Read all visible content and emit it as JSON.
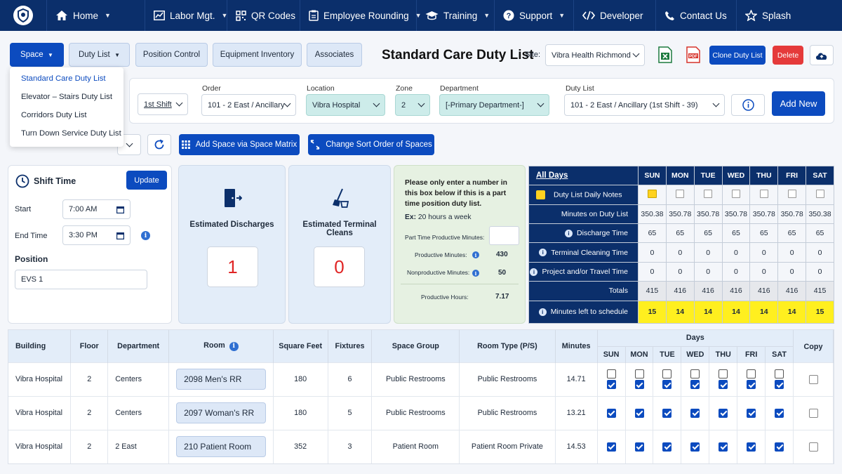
{
  "nav": {
    "items": [
      {
        "label": "Home",
        "icon": "house-icon"
      },
      {
        "label": "Labor Mgt.",
        "icon": "chart-icon"
      },
      {
        "label": "QR Codes",
        "icon": "qr-icon"
      },
      {
        "label": "Employee Rounding",
        "icon": "clipboard-icon"
      },
      {
        "label": "Training",
        "icon": "graduation-cap-icon"
      },
      {
        "label": "Support",
        "icon": "question-icon"
      },
      {
        "label": "Developer",
        "icon": "code-icon"
      },
      {
        "label": "Contact Us",
        "icon": "phone-icon"
      },
      {
        "label": "Splash",
        "icon": "star-icon"
      }
    ]
  },
  "toolbar": {
    "space": "Space",
    "duty_list": "Duty List",
    "position_control": "Position Control",
    "equipment_inventory": "Equipment Inventory",
    "associates": "Associates",
    "page_title": "Standard Care Duty List",
    "site_label": "Site:",
    "site_value": "Vibra Health Richmond",
    "clone": "Clone Duty List",
    "delete": "Delete"
  },
  "space_menu": [
    "Standard Care Duty List",
    "Elevator – Stairs Duty List",
    "Corridors Duty List",
    "Turn Down Service Duty List"
  ],
  "filters": {
    "shift": "1st Shift",
    "order_label": "Order",
    "order": "101 - 2 East / Ancillary",
    "location_label": "Location",
    "location": "Vibra Hospital",
    "zone_label": "Zone",
    "zone": "2",
    "department_label": "Department",
    "department": "[-Primary Department-]",
    "duty_list_label": "Duty List",
    "duty_list": "101 - 2 East / Ancillary (1st Shift - 39)",
    "add_new": "Add New"
  },
  "actions": {
    "add_space": "Add Space via Space Matrix",
    "change_sort": "Change Sort Order of Spaces"
  },
  "shift": {
    "title": "Shift Time",
    "update": "Update",
    "start_label": "Start",
    "start": "7:00 AM",
    "end_label": "End Time",
    "end": "3:30 PM",
    "position_label": "Position",
    "position": "EVS 1"
  },
  "estimates": {
    "discharges_label": "Estimated Discharges",
    "discharges": "1",
    "terminal_label": "Estimated Terminal Cleans",
    "terminal": "0"
  },
  "part_time": {
    "note": "Please only enter a number in this box below if this is a part time position duty list.",
    "example_prefix": "Ex:",
    "example": "20 hours a week",
    "pt_minutes_label": "Part Time Productive Minutes:",
    "productive_label": "Productive Minutes:",
    "productive": "430",
    "nonproductive_label": "Nonproductive Minutes:",
    "nonproductive": "50",
    "hours_label": "Productive Hours:",
    "hours": "7.17"
  },
  "schedule": {
    "all_days": "All Days",
    "days": [
      "SUN",
      "MON",
      "TUE",
      "WED",
      "THU",
      "FRI",
      "SAT"
    ],
    "rows": [
      {
        "label": "Duty List Daily Notes",
        "values": []
      },
      {
        "label": "Minutes on Duty List",
        "values": [
          "350.38",
          "350.78",
          "350.78",
          "350.78",
          "350.78",
          "350.78",
          "350.38"
        ]
      },
      {
        "label": "Discharge Time",
        "values": [
          "65",
          "65",
          "65",
          "65",
          "65",
          "65",
          "65"
        ]
      },
      {
        "label": "Terminal Cleaning Time",
        "values": [
          "0",
          "0",
          "0",
          "0",
          "0",
          "0",
          "0"
        ]
      },
      {
        "label": "Project and/or Travel Time",
        "values": [
          "0",
          "0",
          "0",
          "0",
          "0",
          "0",
          "0"
        ]
      },
      {
        "label": "Totals",
        "values": [
          "415",
          "416",
          "416",
          "416",
          "416",
          "416",
          "415"
        ]
      },
      {
        "label": "Minutes left to schedule",
        "values": [
          "15",
          "14",
          "14",
          "14",
          "14",
          "14",
          "15"
        ]
      }
    ]
  },
  "grid": {
    "headers": {
      "building": "Building",
      "floor": "Floor",
      "department": "Department",
      "room": "Room",
      "sqft": "Square Feet",
      "fixtures": "Fixtures",
      "space_group": "Space Group",
      "room_type": "Room Type (P/S)",
      "minutes": "Minutes",
      "days": "Days",
      "copy": "Copy"
    },
    "days": [
      "SUN",
      "MON",
      "TUE",
      "WED",
      "THU",
      "FRI",
      "SAT"
    ],
    "rows": [
      {
        "building": "Vibra Hospital",
        "floor": "2",
        "department": "Centers",
        "room": "2098 Men's RR",
        "sqft": "180",
        "fixtures": "6",
        "space_group": "Public Restrooms",
        "room_type": "Public Restrooms",
        "minutes": "14.71"
      },
      {
        "building": "Vibra Hospital",
        "floor": "2",
        "department": "Centers",
        "room": "2097 Woman's RR",
        "sqft": "180",
        "fixtures": "5",
        "space_group": "Public Restrooms",
        "room_type": "Public Restrooms",
        "minutes": "13.21"
      },
      {
        "building": "Vibra Hospital",
        "floor": "2",
        "department": "2 East",
        "room": "210 Patient Room",
        "sqft": "352",
        "fixtures": "3",
        "space_group": "Patient Room",
        "room_type": "Patient Room Private",
        "minutes": "14.53"
      }
    ]
  }
}
